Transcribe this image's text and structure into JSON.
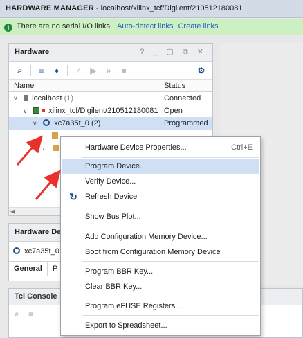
{
  "title_bar": {
    "section": "HARDWARE MANAGER",
    "path": " - localhost/xilinx_tcf/Digilent/210512180081"
  },
  "info_bar": {
    "message": "There are no serial I/O links.",
    "link_auto": "Auto-detect links",
    "link_create": "Create links"
  },
  "hardware_panel": {
    "title": "Hardware",
    "window_buttons": "? _ ▢ ⧉ ✕",
    "columns": {
      "name": "Name",
      "status": "Status"
    },
    "rows": [
      {
        "name": "localhost",
        "count": "(1)",
        "status": "Connected"
      },
      {
        "name": "xilinx_tcf/Digilent/210512180081",
        "status": "Open"
      },
      {
        "name": "xc7a35t_0",
        "count": "(2)",
        "status": "Programmed"
      }
    ]
  },
  "hw_device_panel": {
    "title": "Hardware De",
    "device": "xc7a35t_0",
    "tabs": [
      "General",
      "P"
    ]
  },
  "tcl_panel": {
    "title": "Tcl Console"
  },
  "context_menu": {
    "items": [
      {
        "label": "Hardware Device Properties...",
        "shortcut": "Ctrl+E"
      },
      {
        "label": "Program Device..."
      },
      {
        "label": "Verify Device..."
      },
      {
        "label": "Refresh Device"
      },
      {
        "label": "Show Bus Plot..."
      },
      {
        "label": "Add Configuration Memory Device..."
      },
      {
        "label": "Boot from Configuration Memory Device"
      },
      {
        "label": "Program BBR Key..."
      },
      {
        "label": "Clear BBR Key..."
      },
      {
        "label": "Program eFUSE Registers..."
      },
      {
        "label": "Export to Spreadsheet..."
      }
    ],
    "highlighted_item": "Program Device...",
    "highlight_color": "#cfe0f5"
  },
  "annotation_arrow_color": "#e8312a"
}
